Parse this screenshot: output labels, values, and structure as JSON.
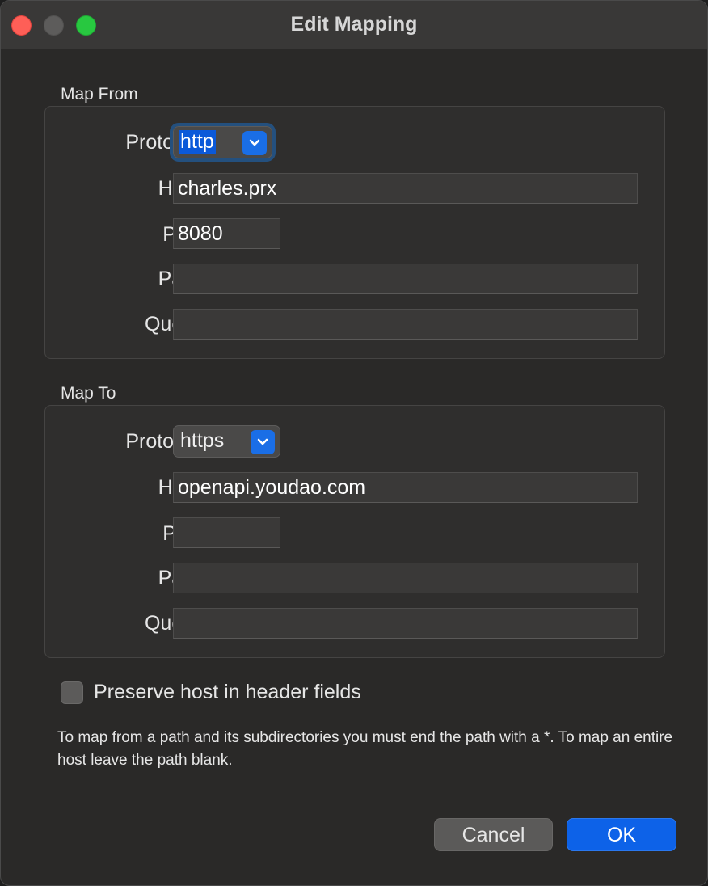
{
  "window": {
    "title": "Edit Mapping"
  },
  "map_from": {
    "title": "Map From",
    "protocol_label": "Protocol:",
    "protocol_value": "http",
    "host_label": "Host:",
    "host_value": "charles.prx",
    "port_label": "Port:",
    "port_value": "8080",
    "path_label": "Path:",
    "path_value": "",
    "query_label": "Query:",
    "query_value": ""
  },
  "map_to": {
    "title": "Map To",
    "protocol_label": "Protocol:",
    "protocol_value": "https",
    "host_label": "Host:",
    "host_value": "openapi.youdao.com",
    "port_label": "Port:",
    "port_value": "",
    "path_label": "Path:",
    "path_value": "",
    "query_label": "Query:",
    "query_value": ""
  },
  "preserve_host": {
    "label": "Preserve host in header fields",
    "checked": false
  },
  "help_text": "To map from a path and its subdirectories you must end the path with a *. To map an entire host leave the path blank.",
  "buttons": {
    "cancel": "Cancel",
    "ok": "OK"
  },
  "colors": {
    "accent": "#0d62e8",
    "close": "#fe5f57",
    "zoom": "#28c840"
  }
}
